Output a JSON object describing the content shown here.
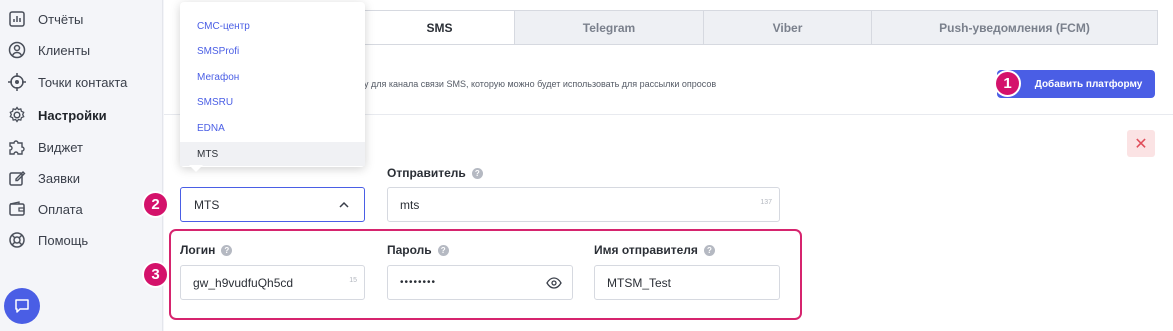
{
  "sidebar": {
    "items": [
      {
        "label": "Отчёты",
        "icon": "reports-icon"
      },
      {
        "label": "Клиенты",
        "icon": "user-icon"
      },
      {
        "label": "Точки контакта",
        "icon": "target-icon"
      },
      {
        "label": "Настройки",
        "icon": "gear-icon"
      },
      {
        "label": "Виджет",
        "icon": "puzzle-icon"
      },
      {
        "label": "Заявки",
        "icon": "edit-icon"
      },
      {
        "label": "Оплата",
        "icon": "wallet-icon"
      },
      {
        "label": "Помощь",
        "icon": "lifebuoy-icon"
      }
    ],
    "active_index": 3,
    "chat_icon": "chat-icon"
  },
  "tabs": [
    {
      "label": "SMS",
      "active": true
    },
    {
      "label": "Telegram",
      "active": false
    },
    {
      "label": "Viber",
      "active": false
    },
    {
      "label": "Push-уведомления (FCM)",
      "active": false
    }
  ],
  "description": "у для канала связи SMS, которую можно будет использовать для рассылки опросов",
  "add_button_label": "Добавить платформу",
  "delete_icon": "close-icon",
  "dropdown": {
    "options": [
      "СМС-центр",
      "SMSProfi",
      "Мегафон",
      "SMSRU",
      "EDNA",
      "MTS"
    ],
    "selected": "MTS"
  },
  "platform_select": {
    "value": "MTS"
  },
  "sender": {
    "label": "Отправитель",
    "value": "mts",
    "counter": "137"
  },
  "login": {
    "label": "Логин",
    "value": "gw_h9vudfuQh5cd",
    "counter": "15"
  },
  "password": {
    "label": "Пароль",
    "value": "••••••••"
  },
  "sender_name": {
    "label": "Имя отправителя",
    "value": "MTSM_Test"
  },
  "help_glyph": "?",
  "badges": [
    "1",
    "2",
    "3"
  ],
  "colors": {
    "accent": "#4a5ee5",
    "badge": "#d4126b",
    "danger": "#e04d5a"
  }
}
